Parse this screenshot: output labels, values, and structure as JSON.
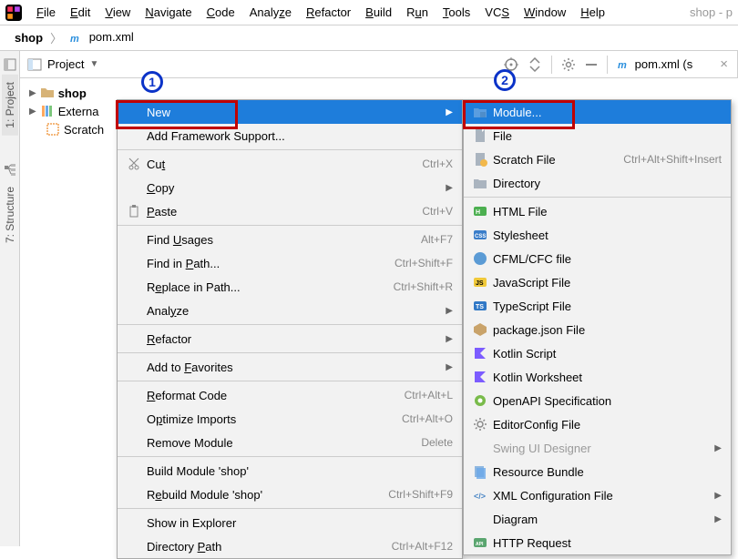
{
  "window": {
    "project_hint": "shop - p"
  },
  "menubar": {
    "items": [
      "File",
      "Edit",
      "View",
      "Navigate",
      "Code",
      "Analyze",
      "Refactor",
      "Build",
      "Run",
      "Tools",
      "VCS",
      "Window",
      "Help"
    ]
  },
  "breadcrumb": {
    "root": "shop",
    "file": "pom.xml"
  },
  "left_tabs": {
    "project": "1: Project",
    "structure": "7: Structure"
  },
  "toolbar": {
    "project_label": "Project",
    "tab_label": "pom.xml (s"
  },
  "tree": {
    "shop": "shop",
    "external": "Externa",
    "scratches": "Scratch"
  },
  "context_menu": {
    "items": [
      {
        "label": "New",
        "selected": true,
        "arrow": true
      },
      {
        "label": "Add Framework Support..."
      },
      {
        "sep": true
      },
      {
        "label": "Cut",
        "icon": "scissors",
        "shortcut": "Ctrl+X",
        "underline_index": 2
      },
      {
        "label": "Copy",
        "arrow": true,
        "underline_index": 0
      },
      {
        "label": "Paste",
        "icon": "clipboard",
        "shortcut": "Ctrl+V",
        "underline_index": 0
      },
      {
        "sep": true
      },
      {
        "label": "Find Usages",
        "shortcut": "Alt+F7",
        "underline_index": 5
      },
      {
        "label": "Find in Path...",
        "shortcut": "Ctrl+Shift+F",
        "underline_index": 8
      },
      {
        "label": "Replace in Path...",
        "shortcut": "Ctrl+Shift+R",
        "underline_index": 1
      },
      {
        "label": "Analyze",
        "arrow": true,
        "underline_index": 4
      },
      {
        "sep": true
      },
      {
        "label": "Refactor",
        "arrow": true,
        "underline_index": 0
      },
      {
        "sep": true
      },
      {
        "label": "Add to Favorites",
        "arrow": true,
        "underline_index": 7
      },
      {
        "sep": true
      },
      {
        "label": "Reformat Code",
        "shortcut": "Ctrl+Alt+L",
        "underline_index": 0
      },
      {
        "label": "Optimize Imports",
        "shortcut": "Ctrl+Alt+O",
        "underline_index": 1
      },
      {
        "label": "Remove Module",
        "shortcut": "Delete"
      },
      {
        "sep": true
      },
      {
        "label": "Build Module 'shop'"
      },
      {
        "label": "Rebuild Module 'shop'",
        "shortcut": "Ctrl+Shift+F9",
        "underline_index": 1
      },
      {
        "sep": true
      },
      {
        "label": "Show in Explorer"
      },
      {
        "label": "Directory Path",
        "shortcut": "Ctrl+Alt+F12",
        "underline_index": 10
      }
    ]
  },
  "submenu": {
    "items": [
      {
        "label": "Module...",
        "icon": "module",
        "selected": true
      },
      {
        "label": "File",
        "icon": "file"
      },
      {
        "label": "Scratch File",
        "icon": "scratch",
        "shortcut": "Ctrl+Alt+Shift+Insert"
      },
      {
        "label": "Directory",
        "icon": "folder"
      },
      {
        "sep": true
      },
      {
        "label": "HTML File",
        "icon": "html"
      },
      {
        "label": "Stylesheet",
        "icon": "css"
      },
      {
        "label": "CFML/CFC file",
        "icon": "cf"
      },
      {
        "label": "JavaScript File",
        "icon": "js"
      },
      {
        "label": "TypeScript File",
        "icon": "ts"
      },
      {
        "label": "package.json File",
        "icon": "pkg"
      },
      {
        "label": "Kotlin Script",
        "icon": "kt"
      },
      {
        "label": "Kotlin Worksheet",
        "icon": "kt"
      },
      {
        "label": "OpenAPI Specification",
        "icon": "openapi"
      },
      {
        "label": "EditorConfig File",
        "icon": "gear"
      },
      {
        "label": "Swing UI Designer",
        "arrow": true,
        "disabled": true
      },
      {
        "label": "Resource Bundle",
        "icon": "bundle"
      },
      {
        "label": "XML Configuration File",
        "icon": "xml",
        "arrow": true
      },
      {
        "label": "Diagram",
        "arrow": true
      },
      {
        "label": "HTTP Request",
        "icon": "http"
      }
    ]
  },
  "annotations": {
    "badge1": "1",
    "badge2": "2"
  }
}
